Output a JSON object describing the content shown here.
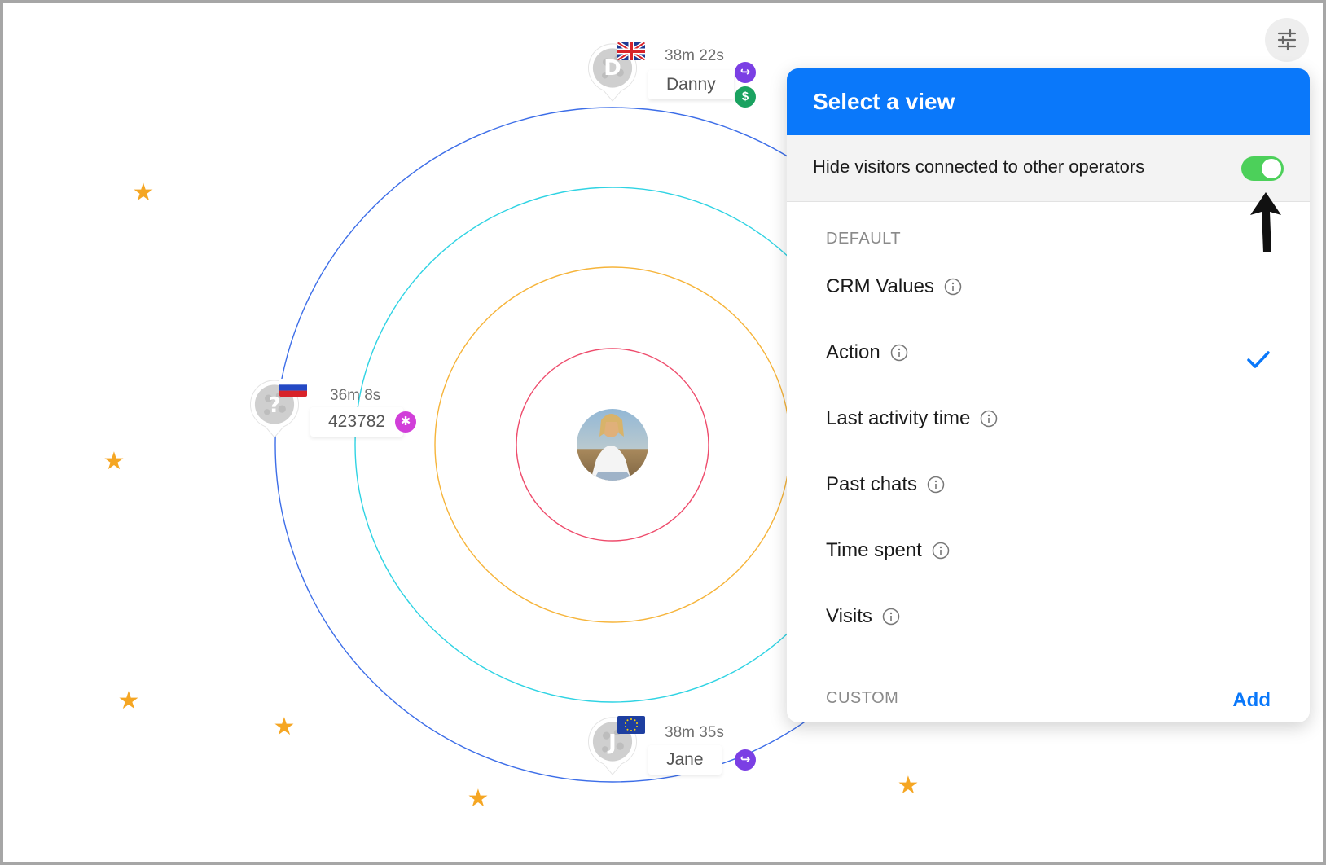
{
  "operator": {
    "avatar_icon": "operator-photo"
  },
  "visitors": [
    {
      "id": "danny",
      "time": "38m 22s",
      "name": "Danny",
      "initial": "D",
      "flag": "gb-flag-icon",
      "badges": [
        {
          "icon": "transfer-icon",
          "color": "#7b3fe4"
        },
        {
          "icon": "dollar-icon",
          "color": "#1aa260"
        }
      ]
    },
    {
      "id": "visitor-423782",
      "time": "36m 8s",
      "name": "423782",
      "initial": "?",
      "flag": "ru-flag-icon",
      "badges": [
        {
          "icon": "asterisk-icon",
          "color": "#d13fd9"
        }
      ]
    },
    {
      "id": "jane",
      "time": "38m 35s",
      "name": "Jane",
      "initial": "J",
      "flag": "eu-flag-icon",
      "badges": [
        {
          "icon": "transfer-icon",
          "color": "#7b3fe4"
        }
      ]
    }
  ],
  "ring_colors": [
    "#ee4c6c",
    "#f6b43a",
    "#2fd3e3",
    "#3d6ee8"
  ],
  "panel": {
    "title": "Select a view",
    "toggle_label": "Hide visitors connected to other operators",
    "toggle_on": true,
    "default_header": "DEFAULT",
    "items": [
      {
        "label": "CRM Values",
        "selected": false
      },
      {
        "label": "Action",
        "selected": true
      },
      {
        "label": "Last activity time",
        "selected": false
      },
      {
        "label": "Past chats",
        "selected": false
      },
      {
        "label": "Time spent",
        "selected": false
      },
      {
        "label": "Visits",
        "selected": false
      }
    ],
    "custom_header": "CUSTOM",
    "add_label": "Add"
  },
  "colors": {
    "accent": "#0a78fa",
    "toggle": "#4cd05a",
    "star": "#f5a623"
  }
}
